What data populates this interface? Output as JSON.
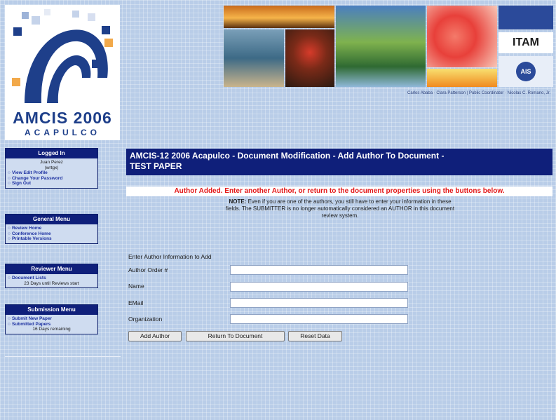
{
  "logo": {
    "title": "AMCIS 2006",
    "subtitle": "ACAPULCO"
  },
  "header": {
    "sponsor_itam": "ITAM",
    "sponsor_ais": "AIS",
    "credits": "Carlos Ababa · Clara Patterson | Public Coordinator · Nicolas C. Romano, Jr."
  },
  "sidebar": {
    "logged_in": {
      "title": "Logged In",
      "user_name": "Juan Perez",
      "user_id": "(wrtgx)",
      "items": [
        "View Edit Profile",
        "Change Your Password",
        "Sign Out"
      ]
    },
    "general_menu": {
      "title": "General Menu",
      "items": [
        "Review Home",
        "Conference Home",
        "Printable Versions"
      ]
    },
    "reviewer_menu": {
      "title": "Reviewer Menu",
      "items": [
        "Document Lists"
      ],
      "note": "23 Days until Reviews start"
    },
    "submission_menu": {
      "title": "Submission Menu",
      "items": [
        "Submit New Paper",
        "Submitted Papers"
      ],
      "note": "16 Days remaining"
    }
  },
  "main": {
    "title_line1": "AMCIS-12 2006 Acapulco - Document Modification - Add Author To Document -",
    "title_line2": "TEST PAPER",
    "message": "Author Added. Enter another Author, or return to the document properties using the buttons below.",
    "note_label": "NOTE:",
    "note_text": "Even if you are one of the authors, you still have to enter your information in these fields. The SUBMITTER is no longer automatically considered an AUTHOR in this document review system.",
    "form_heading": "Enter Author Information to Add",
    "fields": {
      "order_label": "Author Order #",
      "name_label": "Name",
      "email_label": "EMail",
      "org_label": "Organization",
      "order_value": "",
      "name_value": "",
      "email_value": "",
      "org_value": ""
    },
    "buttons": {
      "add": "Add Author",
      "return": "Return To Document",
      "reset": "Reset Data"
    }
  },
  "colors": {
    "header_blue": "#0f1f7a",
    "message_red": "#e31818",
    "page_bg": "#b9cde8"
  }
}
